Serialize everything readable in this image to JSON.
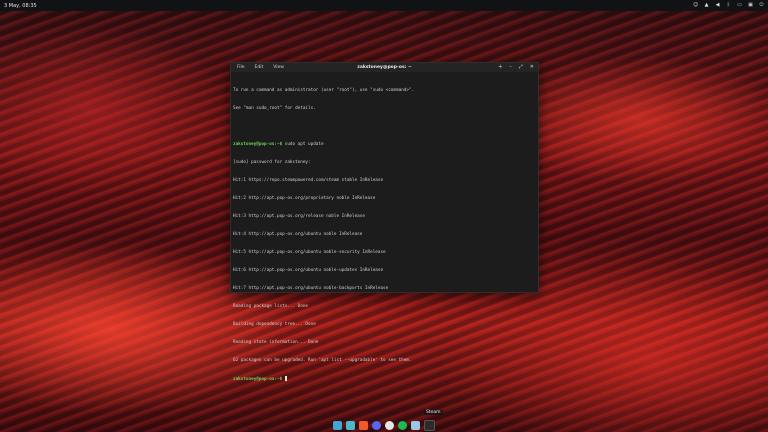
{
  "topbar": {
    "clock": "3 May, 08:35",
    "tray_icons": [
      "people-icon",
      "network-icon",
      "volume-icon",
      "bluetooth-icon",
      "battery-icon",
      "display-icon",
      "power-icon"
    ]
  },
  "terminal": {
    "menu": [
      "File",
      "Edit",
      "View"
    ],
    "title": "zakstoney@pop-os: ~",
    "controls": [
      "+",
      "–",
      "⤢",
      "✕"
    ],
    "lines": [
      {
        "text": "To run a command as administrator (user \"root\"), use \"sudo <command>\"."
      },
      {
        "text": "See \"man sudo_root\" for details."
      },
      {
        "text": ""
      },
      {
        "prompt": "zakstoney@pop-os:~$",
        "text": " sudo apt update"
      },
      {
        "text": "[sudo] password for zakstoney:"
      },
      {
        "text": "Hit:1 https://repo.steampowered.com/steam stable InRelease"
      },
      {
        "text": "Hit:2 http://apt.pop-os.org/proprietary noble InRelease"
      },
      {
        "text": "Hit:3 http://apt.pop-os.org/release noble InRelease"
      },
      {
        "text": "Hit:4 http://apt.pop-os.org/ubuntu noble InRelease"
      },
      {
        "text": "Hit:5 http://apt.pop-os.org/ubuntu noble-security InRelease"
      },
      {
        "text": "Hit:6 http://apt.pop-os.org/ubuntu noble-updates InRelease"
      },
      {
        "text": "Hit:7 http://apt.pop-os.org/ubuntu noble-backports InRelease"
      },
      {
        "text": "Reading package lists... Done"
      },
      {
        "text": "Building dependency tree... Done"
      },
      {
        "text": "Reading state information... Done"
      },
      {
        "text": "62 packages can be upgraded. Run 'apt list --upgradable' to see them."
      },
      {
        "prompt": "zakstoney@pop-os:~$",
        "text": " "
      }
    ]
  },
  "dock": {
    "tooltip": "Steam",
    "apps": [
      {
        "name": "app-grid-icon",
        "color": "#3fa7d6"
      },
      {
        "name": "files-icon",
        "color": "#48b9c7"
      },
      {
        "name": "brave-icon",
        "color": "#f05a28"
      },
      {
        "name": "discord-icon",
        "color": "#5865f2"
      },
      {
        "name": "chrome-icon",
        "color": "#e6e6e6"
      },
      {
        "name": "spotify-icon",
        "color": "#1db954"
      },
      {
        "name": "steam-icon",
        "color": "#9cc6e8"
      },
      {
        "name": "terminal-icon",
        "color": "#2b2b2b"
      }
    ]
  }
}
